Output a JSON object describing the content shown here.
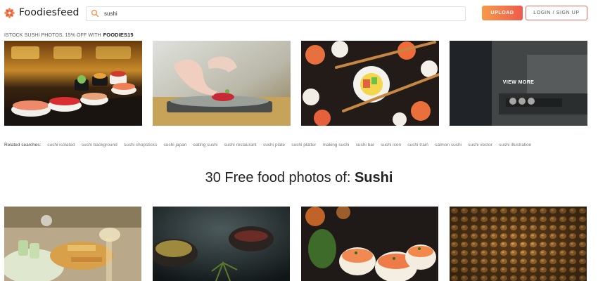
{
  "brand": {
    "name": "Foodiesfeed",
    "accent": "#ef6a4c"
  },
  "search": {
    "value": "sushi",
    "placeholder": ""
  },
  "header": {
    "upload_label": "UPLOAD",
    "login_label": "LOGIN / SIGN UP"
  },
  "promo": {
    "text": "ISTOCK SUSHI PHOTOS, 15% OFF WITH",
    "code": "FOODIES15"
  },
  "top_images": {
    "view_more_label": "VIEW MORE",
    "items": [
      {
        "icon": "sushi-platter-photo"
      },
      {
        "icon": "chef-plating-sushi-photo"
      },
      {
        "icon": "chopsticks-sushi-roll-photo"
      },
      {
        "icon": "sushi-preparation-photo"
      }
    ]
  },
  "related": {
    "label": "Related searches:",
    "links": [
      "sushi isolated",
      "sushi background",
      "sushi chopsticks",
      "sushi japan",
      "eating sushi",
      "sushi restaurant",
      "sushi plate",
      "sushi platter",
      "making sushi",
      "sushi bar",
      "sushi icon",
      "sushi train",
      "salmon sushi",
      "sushi vector",
      "sushi illustration"
    ]
  },
  "results": {
    "prefix": "30 Free food photos of: ",
    "term": "Sushi"
  }
}
